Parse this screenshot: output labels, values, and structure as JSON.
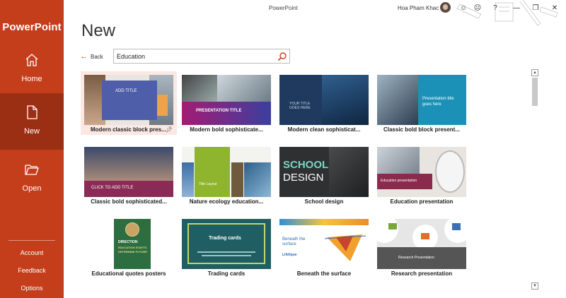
{
  "app": {
    "title": "PowerPoint",
    "brand": "PowerPoint"
  },
  "user": {
    "name": "Hoa Pham Khac"
  },
  "sidebar": {
    "home": "Home",
    "new": "New",
    "open": "Open",
    "account": "Account",
    "feedback": "Feedback",
    "options": "Options"
  },
  "page": {
    "title": "New",
    "back_label": "Back"
  },
  "search": {
    "value": "Education"
  },
  "templates": [
    {
      "caption": "Modern classic block pres...",
      "thumb_text": "ADD TITLE",
      "thumb_sub": ""
    },
    {
      "caption": "Modern bold sophisticate...",
      "thumb_text": "PRESENTATION TITLE",
      "thumb_sub": ""
    },
    {
      "caption": "Modern clean sophisticat...",
      "thumb_text": "YOUR TITLE GOES HERE",
      "thumb_sub": ""
    },
    {
      "caption": "Classic bold block present...",
      "thumb_text": "Presentation title goes here",
      "thumb_sub": ""
    },
    {
      "caption": "Classic bold sophisticated...",
      "thumb_text": "CLICK TO ADD TITLE",
      "thumb_sub": ""
    },
    {
      "caption": "Nature ecology education...",
      "thumb_text": "Title Layout",
      "thumb_sub": ""
    },
    {
      "caption": "School design",
      "thumb_text": "SCHOOL",
      "thumb_sub": "DESIGN"
    },
    {
      "caption": "Education presentation",
      "thumb_text": "Education presentation",
      "thumb_sub": ""
    },
    {
      "caption": "Educational quotes posters",
      "thumb_text": "DIRECTION",
      "thumb_sub": "EDUCATION STARTS DETERMINE FUTURE"
    },
    {
      "caption": "Trading cards",
      "thumb_text": "Trading cards",
      "thumb_sub": ""
    },
    {
      "caption": "Beneath the surface",
      "thumb_text": "Beneath the surface",
      "thumb_sub": "Lifelique"
    },
    {
      "caption": "Research presentation",
      "thumb_text": "Research Presentation",
      "thumb_sub": ""
    }
  ],
  "colors": {
    "accent": "#c43e1c",
    "accent_dark": "#9b2f14"
  }
}
